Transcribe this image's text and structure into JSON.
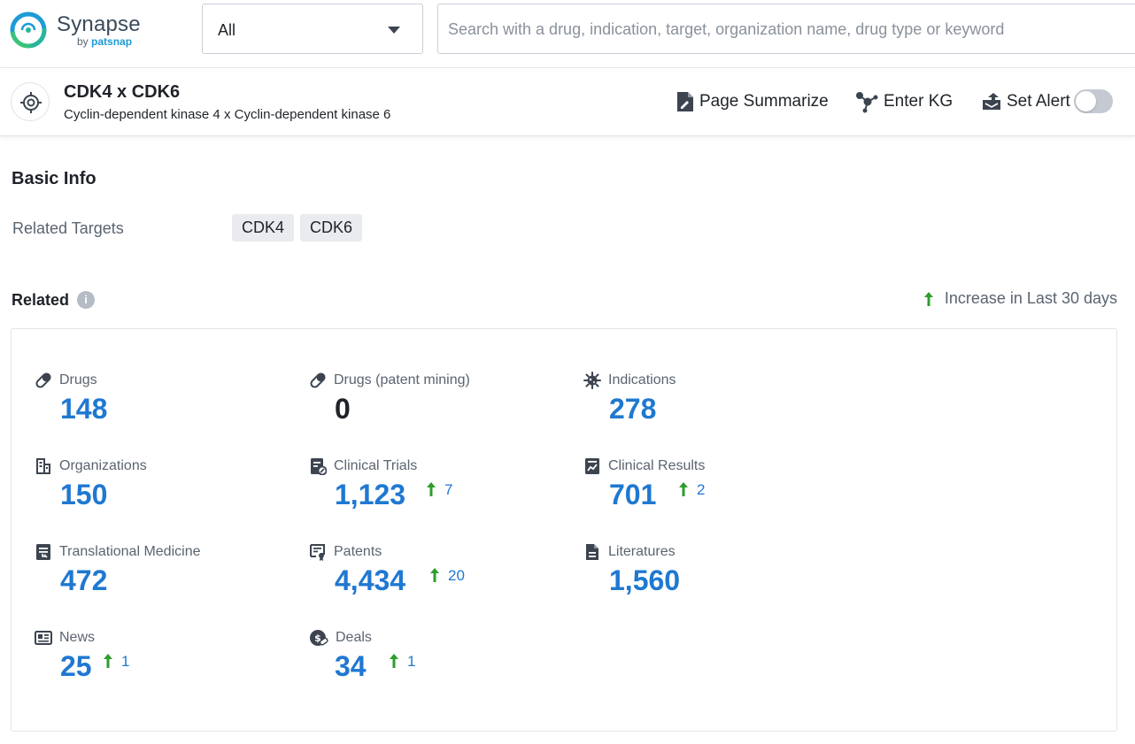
{
  "app": {
    "name": "Synapse",
    "by_prefix": "by",
    "by_brand": "patsnap"
  },
  "search": {
    "scope": "All",
    "placeholder": "Search with a drug, indication, target, organization name, drug type or keyword"
  },
  "header": {
    "title": "CDK4 x CDK6",
    "subtitle": "Cyclin-dependent kinase 4 x Cyclin-dependent kinase 6",
    "actions": {
      "summarize": "Page Summarize",
      "kg": "Enter KG",
      "alert": "Set Alert"
    },
    "alert_on": false
  },
  "basic_info": {
    "title": "Basic Info",
    "related_targets_label": "Related Targets",
    "targets": [
      "CDK4",
      "CDK6"
    ]
  },
  "related": {
    "title": "Related",
    "legend": "Increase in Last 30 days",
    "accent_color": "#1f78d1",
    "increase_color": "#2e9d2e",
    "stats": [
      {
        "label": "Drugs",
        "icon": "pill-icon",
        "value": "148"
      },
      {
        "label": "Drugs (patent mining)",
        "icon": "pill-icon",
        "value": "0"
      },
      {
        "label": "Indications",
        "icon": "virus-icon",
        "value": "278"
      },
      {
        "label": "Organizations",
        "icon": "building-icon",
        "value": "150"
      },
      {
        "label": "Clinical Trials",
        "icon": "clinical-trials-icon",
        "value": "1,123",
        "increase": "7"
      },
      {
        "label": "Clinical Results",
        "icon": "clinical-results-icon",
        "value": "701",
        "increase": "2"
      },
      {
        "label": "Translational Medicine",
        "icon": "translational-medicine-icon",
        "value": "472"
      },
      {
        "label": "Patents",
        "icon": "patent-icon",
        "value": "4,434",
        "increase": "20"
      },
      {
        "label": "Literatures",
        "icon": "document-icon",
        "value": "1,560"
      },
      {
        "label": "News",
        "icon": "news-icon",
        "value": "25",
        "increase": "1"
      },
      {
        "label": "Deals",
        "icon": "deals-icon",
        "value": "34",
        "increase": "1"
      }
    ]
  }
}
